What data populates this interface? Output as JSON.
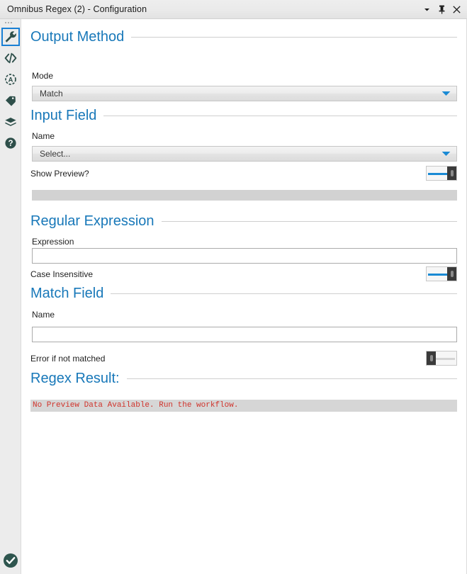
{
  "window": {
    "title": "Omnibus Regex (2) - Configuration",
    "titlebar_buttons": [
      {
        "name": "window-menu-chevron-icon",
        "label": "▾"
      },
      {
        "name": "pin-icon",
        "label": "⚐"
      },
      {
        "name": "close-icon",
        "label": "✕"
      }
    ]
  },
  "colors": {
    "accent_blue": "#1878b9",
    "toggle_on": "#1a8ad4",
    "error_red": "#d0342c",
    "rail_icon": "#2e4f4a",
    "selection_border": "#1a7fd4",
    "check_green": "#2e554e"
  },
  "rail": {
    "items": [
      {
        "icon": "wrench-icon",
        "label": "Configuration",
        "selected": true
      },
      {
        "icon": "code-brackets-icon",
        "label": "XML",
        "selected": false
      },
      {
        "icon": "annotation-target-icon",
        "label": "Annotation",
        "selected": false
      },
      {
        "icon": "tag-icon",
        "label": "Tag",
        "selected": false
      },
      {
        "icon": "package-icon",
        "label": "Package",
        "selected": false
      },
      {
        "icon": "help-question-icon",
        "label": "Help",
        "selected": false
      }
    ],
    "status": {
      "icon": "check-circle-icon",
      "label": "Valid"
    }
  },
  "sections": {
    "output_method": {
      "title": "Output Method",
      "mode": {
        "label": "Mode",
        "value": "Match",
        "arrow_icon": "chevron-down-icon"
      }
    },
    "input_field": {
      "title": "Input Field",
      "name": {
        "label": "Name",
        "value": "Select...",
        "arrow_icon": "chevron-down-icon"
      },
      "show_preview": {
        "label": "Show Preview?",
        "state": "on"
      },
      "preview_bar": ""
    },
    "regular_expression": {
      "title": "Regular Expression",
      "expression": {
        "label": "Expression",
        "value": "",
        "placeholder": ""
      },
      "case_insensitive": {
        "label": "Case Insensitive",
        "state": "on"
      }
    },
    "match_field": {
      "title": "Match Field",
      "name": {
        "label": "Name",
        "value": "",
        "placeholder": ""
      },
      "error_if_not_matched": {
        "label": "Error if not matched",
        "state": "off"
      }
    },
    "regex_result": {
      "title": "Regex Result:",
      "message": "No Preview Data Available. Run the workflow."
    }
  }
}
